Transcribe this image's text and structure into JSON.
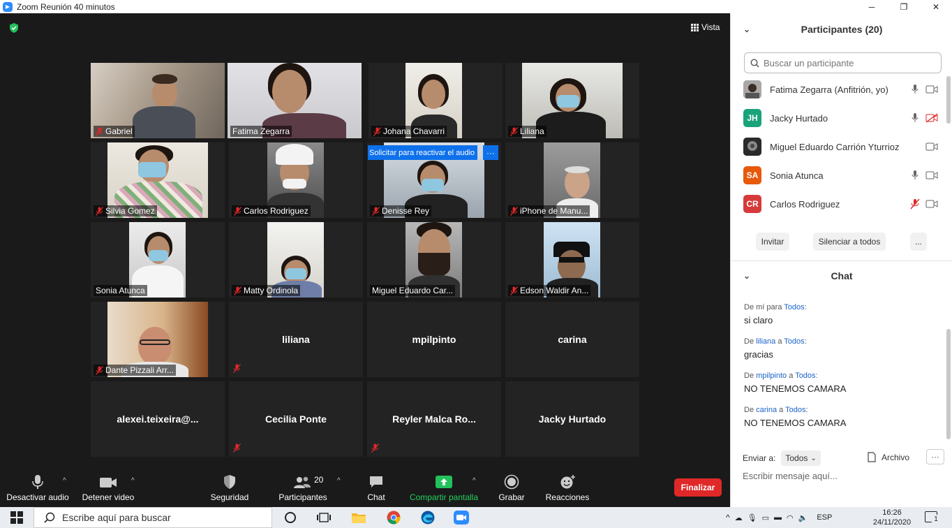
{
  "window": {
    "title": "Zoom Reunión 40 minutos",
    "minimize": "─",
    "restore": "❐",
    "close": "✕"
  },
  "stage": {
    "view_label": "Vista",
    "reactivate_banner": "Solicitar para reactivar el audio",
    "reactivate_more": "···",
    "tiles": [
      {
        "name": "Gabriel",
        "muted": true
      },
      {
        "name": "Fatima Zegarra",
        "muted": false,
        "active": true
      },
      {
        "name": "Johana Chavarri",
        "muted": true
      },
      {
        "name": "Liliana",
        "muted": true
      },
      {
        "name": "Silvia Gomez",
        "muted": true
      },
      {
        "name": "Carlos Rodriguez",
        "muted": true
      },
      {
        "name": "Denisse Rey",
        "muted": true
      },
      {
        "name": "iPhone de Manu...",
        "muted": true
      },
      {
        "name": "Sonia Atunca",
        "muted": false
      },
      {
        "name": "Matty Ordinola",
        "muted": true
      },
      {
        "name": "Miguel Eduardo Car...",
        "muted": false
      },
      {
        "name": "Edson Waldir An...",
        "muted": true
      },
      {
        "name": "Dante Pizzali Arr...",
        "muted": true
      },
      {
        "center": "liliana",
        "muted": true
      },
      {
        "center": "mpilpinto",
        "muted": false
      },
      {
        "center": "carina",
        "muted": false
      },
      {
        "center": "alexei.teixeira@...",
        "muted": false
      },
      {
        "center": "Cecilia Ponte",
        "muted": true
      },
      {
        "center": "Reyler  Malca  Ro...",
        "muted": true
      },
      {
        "center": "Jacky Hurtado",
        "muted": false
      }
    ]
  },
  "toolbar": {
    "audio": "Desactivar audio",
    "video": "Detener video",
    "security": "Seguridad",
    "participants": "Participantes",
    "participants_count": "20",
    "chat": "Chat",
    "share": "Compartir pantalla",
    "record": "Grabar",
    "reactions": "Reacciones",
    "end": "Finalizar"
  },
  "participants_panel": {
    "title": "Participantes (20)",
    "search_placeholder": "Buscar un participante",
    "list": [
      {
        "name": "Fatima Zegarra (Anfitrión, yo)",
        "initials": "",
        "color": "#555555"
      },
      {
        "name": "Jacky Hurtado",
        "initials": "JH",
        "color": "#1aa37a"
      },
      {
        "name": "Miguel Eduardo Carrión Yturrioz",
        "initials": "",
        "color": "#333333"
      },
      {
        "name": "Sonia Atunca",
        "initials": "SA",
        "color": "#e8590c"
      },
      {
        "name": "Carlos Rodriguez",
        "initials": "CR",
        "color": "#d63a3a"
      }
    ],
    "invite": "Invitar",
    "mute_all": "Silenciar a todos",
    "more": "..."
  },
  "chat": {
    "title": "Chat",
    "messages": [
      {
        "prefix": "De ",
        "from": "mí",
        "mid": " para ",
        "to": "Todos",
        "suffix": ":",
        "text": "si claro"
      },
      {
        "prefix": "De ",
        "from": "liliana",
        "mid": " a ",
        "to": "Todos",
        "suffix": ":",
        "text": "gracias"
      },
      {
        "prefix": "De ",
        "from": "mpilpinto",
        "mid": " a ",
        "to": "Todos",
        "suffix": ":",
        "text": "NO TENEMOS CAMARA"
      },
      {
        "prefix": "De ",
        "from": "carina",
        "mid": " a ",
        "to": "Todos",
        "suffix": ":",
        "text": "NO TENEMOS CAMARA"
      }
    ],
    "send_to_label": "Enviar a:",
    "send_to_value": "Todos",
    "file_label": "Archivo",
    "more": "···",
    "input_placeholder": "Escribir mensaje aquí..."
  },
  "taskbar": {
    "search_placeholder": "Escribe aquí para buscar",
    "lang": "ESP",
    "time": "16:26",
    "date": "24/11/2020",
    "notif_count": "1"
  }
}
